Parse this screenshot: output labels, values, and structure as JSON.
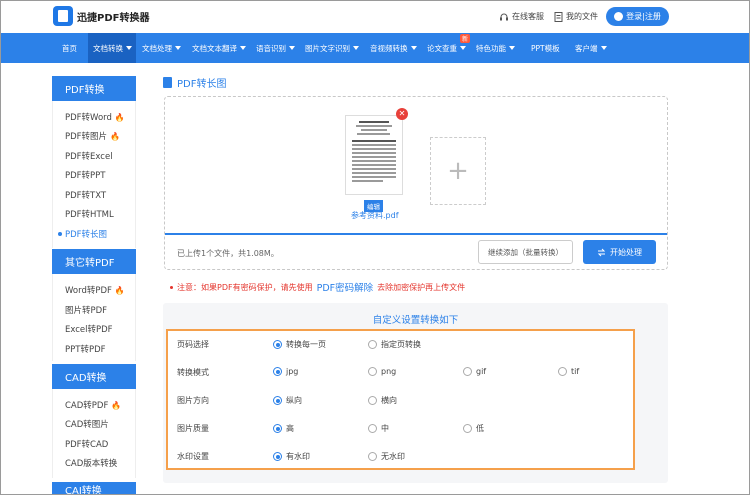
{
  "header": {
    "brand": "迅捷PDF转换器",
    "service": "在线客服",
    "my_files": "我的文件",
    "login": "登录|注册"
  },
  "nav": [
    {
      "label": "首页",
      "caret": false
    },
    {
      "label": "文档转换",
      "caret": true,
      "active": true
    },
    {
      "label": "文档处理",
      "caret": true
    },
    {
      "label": "文档文本翻译",
      "caret": true
    },
    {
      "label": "语音识别",
      "caret": true
    },
    {
      "label": "图片文字识别",
      "caret": true
    },
    {
      "label": "音视频转换",
      "caret": true
    },
    {
      "label": "论文查重",
      "caret": true,
      "badge": "新"
    },
    {
      "label": "特色功能",
      "caret": true
    },
    {
      "label": "PPT模板",
      "caret": false
    },
    {
      "label": "客户端",
      "caret": true
    }
  ],
  "sidebar": {
    "pdf_head": "PDF转换",
    "pdf_items": [
      "PDF转Word",
      "PDF转图片",
      "PDF转Excel",
      "PDF转PPT",
      "PDF转TXT",
      "PDF转HTML",
      "PDF转长图"
    ],
    "other_head": "其它转PDF",
    "other_items": [
      "Word转PDF",
      "图片转PDF",
      "Excel转PDF",
      "PPT转PDF"
    ],
    "cad_head": "CAD转换",
    "cad_items": [
      "CAD转PDF",
      "CAD转图片",
      "PDF转CAD",
      "CAD版本转换"
    ],
    "cai_head": "CAI转换"
  },
  "main": {
    "title": "PDF转长图",
    "file_name": "参考资料.pdf",
    "edit_tag": "编辑",
    "status": "已上传1个文件，共1.08M。",
    "continue_btn": "继续添加（批量转换）",
    "start_btn": "开始处理",
    "notice_prefix": "注意：如果PDF有密码保护，请先使用",
    "notice_link": "PDF密码解除",
    "notice_suffix": "去除加密保护再上传文件"
  },
  "settings": {
    "title": "自定义设置转换如下",
    "rows": [
      {
        "label": "页码选择",
        "options": [
          "转换每一页",
          "指定页转换"
        ],
        "selected": 0
      },
      {
        "label": "转换模式",
        "options": [
          "jpg",
          "png",
          "gif",
          "tif"
        ],
        "selected": 0
      },
      {
        "label": "图片方向",
        "options": [
          "纵向",
          "横向"
        ],
        "selected": 0
      },
      {
        "label": "图片质量",
        "options": [
          "高",
          "中",
          "低"
        ],
        "selected": 0
      },
      {
        "label": "水印设置",
        "options": [
          "有水印",
          "无水印"
        ],
        "selected": 0
      }
    ]
  }
}
